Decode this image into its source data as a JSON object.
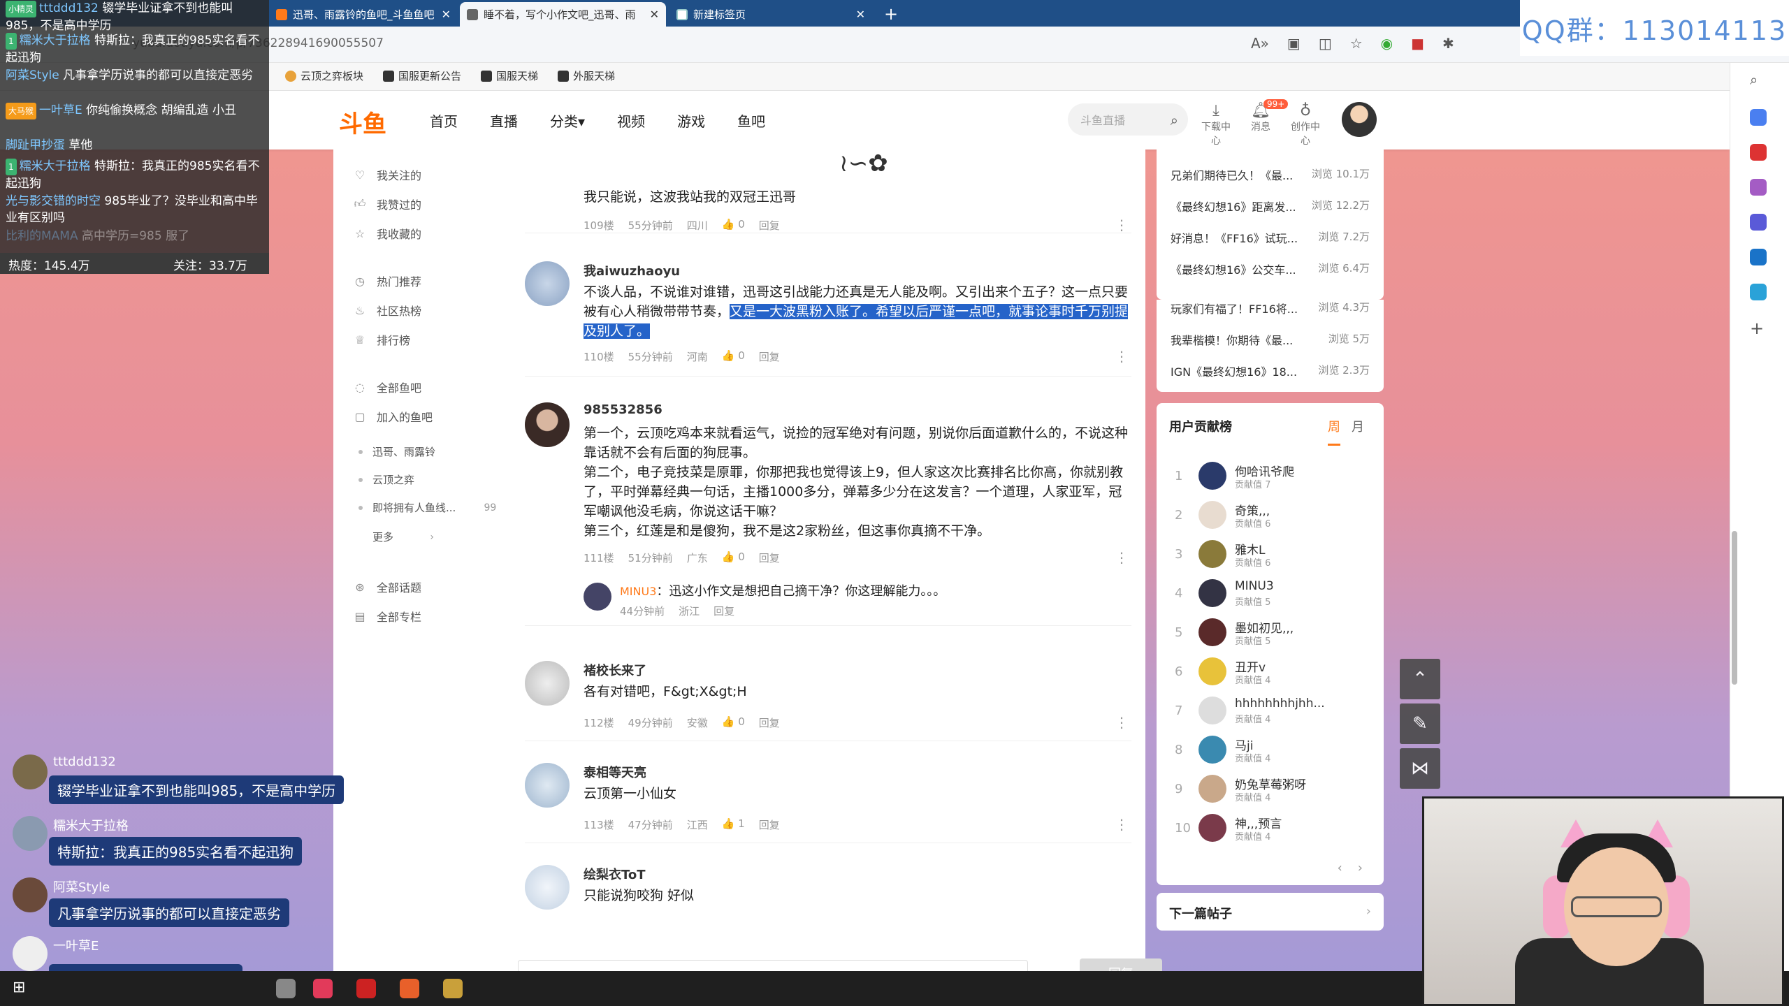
{
  "browser": {
    "tabs": [
      {
        "label": "迅哥、雨露铃的鱼吧_斗鱼鱼吧",
        "active": false
      },
      {
        "label": "睡不着，写个小作文吧_迅哥、雨",
        "active": true
      },
      {
        "label": "新建标签页",
        "active": false
      }
    ],
    "new_tab": "+",
    "close": "✕",
    "url": "yuba.douyu.com/p/736228941690055507",
    "bookmarks": [
      "云顶之弈板块",
      "国服更新公告",
      "国服天梯",
      "外服天梯"
    ]
  },
  "overlay_qq": "QQ群：113014113",
  "site": {
    "logo": "斗鱼",
    "nav": [
      "首页",
      "直播",
      "分类▾",
      "视频",
      "游戏",
      "鱼吧"
    ],
    "search_placeholder": "斗鱼直播",
    "icons": [
      {
        "label": "下载中心",
        "icon": "download-icon"
      },
      {
        "label": "消息",
        "icon": "bell-icon",
        "badge": "99+"
      },
      {
        "label": "创作中心",
        "icon": "bulb-icon"
      }
    ]
  },
  "sidebar": {
    "group1": [
      "我关注的",
      "我赞过的",
      "我收藏的"
    ],
    "group2": [
      "热门推荐",
      "社区热榜",
      "排行榜"
    ],
    "group3": [
      "全部鱼吧",
      "加入的鱼吧"
    ],
    "subs": [
      {
        "label": "迅哥、雨露铃",
        "count": ""
      },
      {
        "label": "云顶之弈",
        "count": ""
      },
      {
        "label": "即将拥有人鱼线...",
        "count": "99"
      },
      {
        "label": "更多",
        "count": "›"
      }
    ],
    "group4": [
      "全部话题",
      "全部专栏"
    ]
  },
  "posts": [
    {
      "floor_text": "我只能说，这波我站我的双冠王迅哥",
      "meta": [
        "109楼",
        "55分钟前",
        "四川",
        "👍 0",
        "回复"
      ]
    },
    {
      "name": "我aiwuzhaoyu",
      "text_a": "不谈人品，不说谁对谁错，迅哥这引战能力还真是无人能及啊。又引出来个五子？这一点只要被有心人稍微带带节奏，",
      "text_hl": "又是一大波黑粉入账了。希望以后严谨一点吧，就事论事时千万别提及别人了。",
      "meta": [
        "110楼",
        "55分钟前",
        "河南",
        "👍 0",
        "回复"
      ]
    },
    {
      "name": "985532856",
      "lines": [
        "第一个，云顶吃鸡本来就看运气，说捡的冠军绝对有问题，别说你后面道歉什么的，不说这种靠话就不会有后面的狗屁事。",
        "第二个，电子竞技菜是原罪，你那把我也觉得该上9，但人家这次比赛排名比你高，你就别教了，平时弹幕经典一句话，主播1000多分，弹幕多少分在这发言？一个道理，人家亚军，冠军嘲讽他没毛病，你说这话干嘛？",
        "第三个，红莲是和是傻狗，我不是这2家粉丝，但这事你真摘不干净。"
      ],
      "meta": [
        "111楼",
        "51分钟前",
        "广东",
        "👍 0",
        "回复"
      ],
      "reply": {
        "user": "MINU3",
        "text": "：迅这小作文是想把自己摘干净？你这理解能力。。。",
        "meta": [
          "44分钟前",
          "浙江",
          "回复"
        ]
      }
    },
    {
      "name": "褚校长来了",
      "text": "各有对错吧，F&gt;X&gt;H",
      "meta": [
        "112楼",
        "49分钟前",
        "安徽",
        "👍 0",
        "回复"
      ]
    },
    {
      "name": "泰相等天亮",
      "text": "云顶第一小仙女",
      "meta": [
        "113楼",
        "47分钟前",
        "江西",
        "👍 1",
        "回复"
      ]
    },
    {
      "name": "绘梨衣ToT",
      "text": "只能说狗咬狗 好似"
    }
  ],
  "reply_button": "回复",
  "hot_list": [
    {
      "title": "兄弟们期待已久！《最...",
      "views": "浏览 10.1万"
    },
    {
      "title": "《最终幻想16》距离发...",
      "views": "浏览 12.2万"
    },
    {
      "title": "好消息！《FF16》试玩...",
      "views": "浏览 7.2万"
    },
    {
      "title": "《最终幻想16》公交车...",
      "views": "浏览 6.4万"
    },
    {
      "title": "玩家们有福了！FF16将...",
      "views": "浏览 4.3万"
    },
    {
      "title": "我辈楷模！你期待《最...",
      "views": "浏览 5万"
    },
    {
      "title": "IGN《最终幻想16》18...",
      "views": "浏览 2.3万"
    }
  ],
  "contrib": {
    "title": "用户贡献榜",
    "tabs": [
      "周",
      "月"
    ],
    "list": [
      {
        "rank": "1",
        "name": "佝哈讯爷爬",
        "score": "贡献值 7"
      },
      {
        "rank": "2",
        "name": "奇策,,,",
        "score": "贡献值 6"
      },
      {
        "rank": "3",
        "name": "雅木L",
        "score": "贡献值 6"
      },
      {
        "rank": "4",
        "name": "MINU3",
        "score": "贡献值 5"
      },
      {
        "rank": "5",
        "name": "墨如初见,,,",
        "score": "贡献值 5"
      },
      {
        "rank": "6",
        "name": "丑开v",
        "score": "贡献值 4"
      },
      {
        "rank": "7",
        "name": "hhhhhhhhjhh...",
        "score": "贡献值 4"
      },
      {
        "rank": "8",
        "name": "马ji",
        "score": "贡献值 4"
      },
      {
        "rank": "9",
        "name": "奶兔草莓粥呀",
        "score": "贡献值 4"
      },
      {
        "rank": "10",
        "name": "神,,,预言",
        "score": "贡献值 4"
      }
    ],
    "prev": "‹",
    "next": "›"
  },
  "next_post": "下一篇帖子",
  "danmu": [
    {
      "user": "tttddd132",
      "text": "辍学毕业证拿不到也能叫985，不是高中学历"
    },
    {
      "user": "糯米大于拉格",
      "text": "特斯拉：我真正的985实名看不起迅狗"
    },
    {
      "user": "阿菜Style",
      "text": "凡事拿学历说事的都可以直接定恶劣"
    },
    {
      "user": "一叶草E",
      "text": "你纯偷换概念 胡编乱造 小丑"
    },
    {
      "user": "脚趾甲抄蛋",
      "text": "草他"
    },
    {
      "user": "糯米大于拉格",
      "text": "特斯拉：我真正的985实名看不起迅狗"
    },
    {
      "user": "光与影交错的时空",
      "text": "985毕业了？没毕业和高中毕业有区别吗"
    },
    {
      "user": "比利的MAMA",
      "text": "高中学历=985 服了"
    }
  ],
  "stats": {
    "heat": "热度：145.4万",
    "follow": "关注：33.7万"
  },
  "chat": [
    {
      "user": "tttddd132",
      "text": "辍学毕业证拿不到也能叫985，不是高中学历"
    },
    {
      "user": "糯米大于拉格",
      "text": "特斯拉：我真正的985实名看不起迅狗"
    },
    {
      "user": "阿菜Style",
      "text": "凡事拿学历说事的都可以直接定恶劣"
    },
    {
      "user": "一叶草E",
      "text": "你纯偷换概念 胡编乱造 小丑"
    }
  ]
}
